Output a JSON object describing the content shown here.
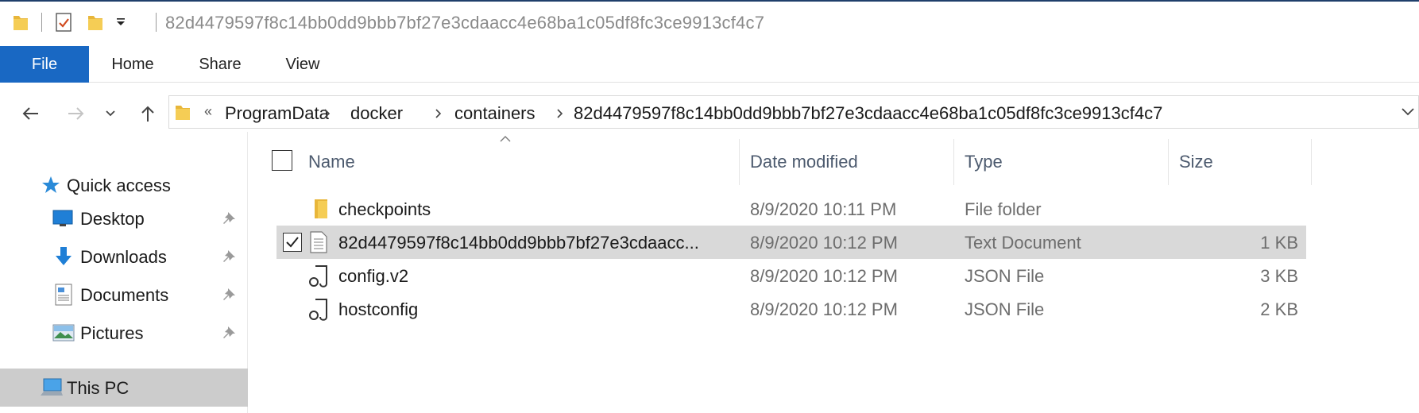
{
  "window": {
    "title": "82d4479597f8c14bb0dd9bbb7bf27e3cdaacc4e68ba1c05df8fc3ce9913cf4c7"
  },
  "ribbon": {
    "tabs": [
      {
        "label": "File"
      },
      {
        "label": "Home"
      },
      {
        "label": "Share"
      },
      {
        "label": "View"
      }
    ]
  },
  "address": {
    "overflow": "«",
    "crumbs": [
      "ProgramData",
      "docker",
      "containers",
      "82d4479597f8c14bb0dd9bbb7bf27e3cdaacc4e68ba1c05df8fc3ce9913cf4c7"
    ]
  },
  "sidebar": {
    "items": [
      {
        "label": "Quick access",
        "icon": "star-icon"
      },
      {
        "label": "Desktop",
        "icon": "desktop-icon",
        "pinned": true
      },
      {
        "label": "Downloads",
        "icon": "download-arrow-icon",
        "pinned": true
      },
      {
        "label": "Documents",
        "icon": "documents-icon",
        "pinned": true
      },
      {
        "label": "Pictures",
        "icon": "pictures-icon",
        "pinned": true
      },
      {
        "label": "This PC",
        "icon": "computer-icon",
        "selected": true
      }
    ]
  },
  "columns": {
    "name": "Name",
    "date": "Date modified",
    "type": "Type",
    "size": "Size"
  },
  "files": [
    {
      "name": "checkpoints",
      "date": "8/9/2020 10:11 PM",
      "type": "File folder",
      "size": "",
      "icon": "folder-icon"
    },
    {
      "name": "82d4479597f8c14bb0dd9bbb7bf27e3cdaacc...",
      "date": "8/9/2020 10:12 PM",
      "type": "Text Document",
      "size": "1 KB",
      "icon": "text-file-icon",
      "selected": true
    },
    {
      "name": "config.v2",
      "date": "8/9/2020 10:12 PM",
      "type": "JSON File",
      "size": "3 KB",
      "icon": "json-file-icon"
    },
    {
      "name": "hostconfig",
      "date": "8/9/2020 10:12 PM",
      "type": "JSON File",
      "size": "2 KB",
      "icon": "json-file-icon"
    }
  ],
  "colors": {
    "accent": "#1968c3",
    "selection": "#d9d9d9",
    "sidebar_selection": "#cccccc"
  }
}
